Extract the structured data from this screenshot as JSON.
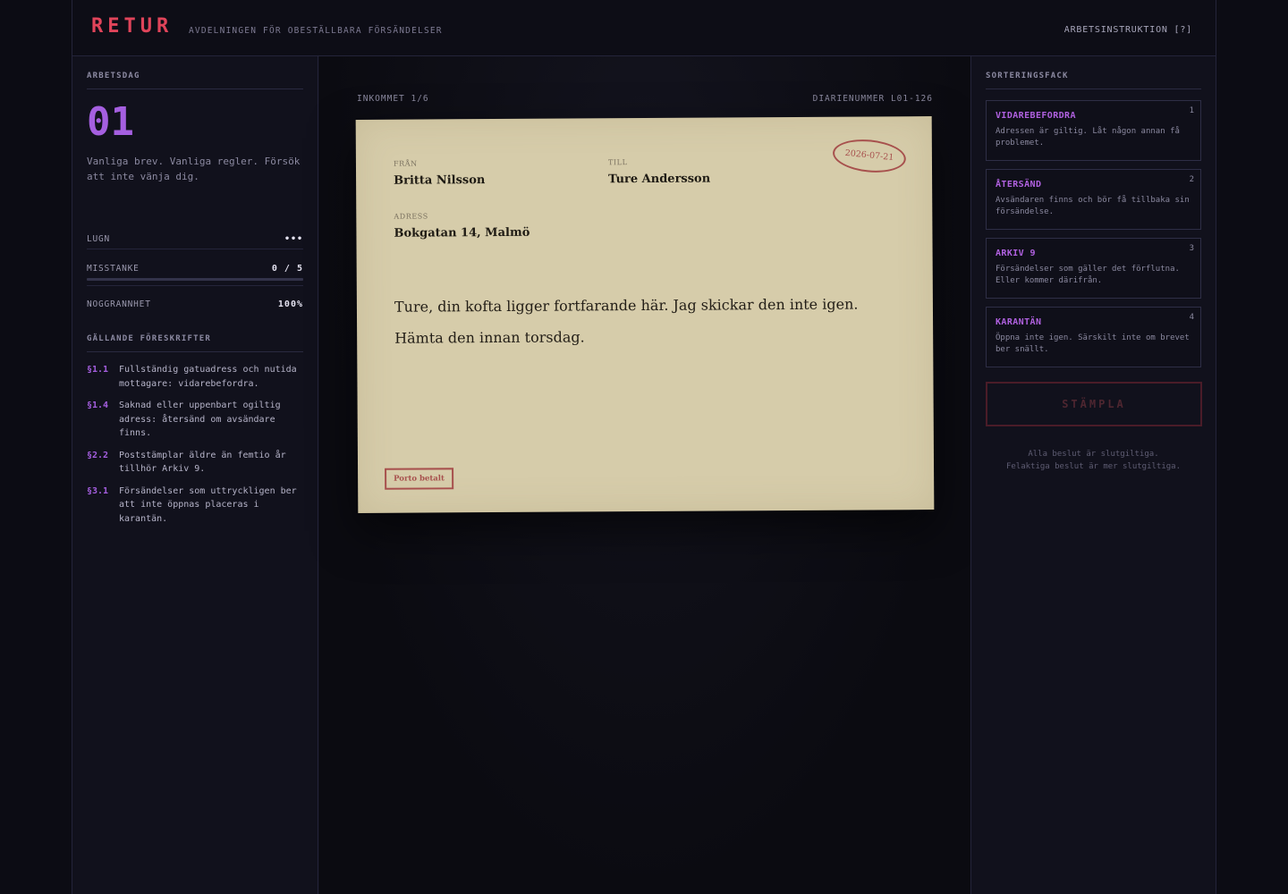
{
  "header": {
    "logo": "RETUR",
    "subtitle": "AVDELNINGEN FÖR OBESTÄLLBARA FÖRSÄNDELSER",
    "help": "ARBETSINSTRUKTION [?]"
  },
  "left": {
    "day_heading": "ARBETSDAG",
    "day_number": "01",
    "day_description": "Vanliga brev. Vanliga regler. Försök att inte vänja dig.",
    "stats": {
      "calm_label": "LUGN",
      "calm_value": "•••",
      "suspicion_label": "MISSTANKE",
      "suspicion_value": "0 / 5",
      "suspicion_fraction": 0,
      "accuracy_label": "NOGGRANNHET",
      "accuracy_value": "100%"
    },
    "rules_heading": "GÄLLANDE FÖRESKRIFTER",
    "rules": [
      {
        "code": "§1.1",
        "text": "Fullständig gatuadress och nutida mottagare: vidarebefordra."
      },
      {
        "code": "§1.4",
        "text": "Saknad eller uppenbart ogiltig adress: återsänd om avsändare finns."
      },
      {
        "code": "§2.2",
        "text": "Poststämplar äldre än femtio år tillhör Arkiv 9."
      },
      {
        "code": "§3.1",
        "text": "Försändelser som uttryckligen ber att inte öppnas placeras i karantän."
      }
    ]
  },
  "center": {
    "incoming": "INKOMMET 1/6",
    "diary": "DIARIENUMMER L01-126",
    "letter": {
      "from_label": "FRÅN",
      "from_value": "Britta Nilsson",
      "to_label": "TILL",
      "to_value": "Ture Andersson",
      "address_label": "ADRESS",
      "address_value": "Bokgatan 14, Malmö",
      "body": "Ture, din kofta ligger fortfarande här. Jag skickar den inte igen. Hämta den innan torsdag.",
      "postmark": "2026-07-21",
      "porto": "Porto betalt"
    }
  },
  "right": {
    "heading": "SORTERINGSFACK",
    "bins": [
      {
        "title": "VIDAREBEFORDRA",
        "desc": "Adressen är giltig. Låt någon annan få problemet.",
        "key": "1"
      },
      {
        "title": "ÅTERSÄND",
        "desc": "Avsändaren finns och bör få tillbaka sin försändelse.",
        "key": "2"
      },
      {
        "title": "ARKIV 9",
        "desc": "Försändelser som gäller det förflutna. Eller kommer därifrån.",
        "key": "3"
      },
      {
        "title": "KARANTÄN",
        "desc": "Öppna inte igen. Särskilt inte om brevet ber snällt.",
        "key": "4"
      }
    ],
    "stamp_label": "STÄMPLA",
    "footnote_1": "Alla beslut är slutgiltiga.",
    "footnote_2": "Felaktiga beslut är mer slutgiltiga."
  },
  "colors": {
    "accent": "#a55fe0",
    "logo": "#e0445a",
    "stamp": "#a7504d"
  }
}
